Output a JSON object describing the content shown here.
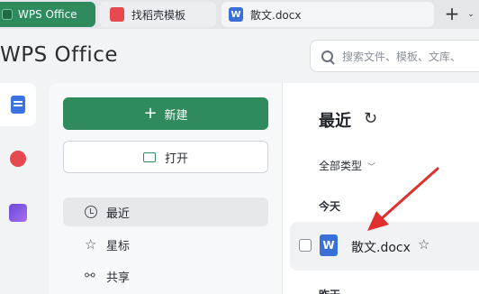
{
  "tabs": [
    {
      "label": "WPS Office",
      "icon": "wps-logo-icon",
      "active": true
    },
    {
      "label": "找稻壳模板",
      "icon": "docer-icon",
      "icon_color": "#e5484d"
    },
    {
      "label": "散文.docx",
      "icon": "word-doc-icon",
      "icon_glyph": "W",
      "icon_color": "#3a6fd8"
    }
  ],
  "tabbar": {
    "new_tab": "+",
    "menu": "⌄"
  },
  "header": {
    "brand": "WPS Office",
    "search_placeholder": "搜索文件、模板、文库、"
  },
  "sidebar": {
    "new_button": "新建",
    "open_button": "打开",
    "nav": [
      {
        "label": "最近",
        "icon": "clock-icon",
        "selected": true
      },
      {
        "label": "星标",
        "icon": "star-icon"
      },
      {
        "label": "共享",
        "icon": "share-icon"
      }
    ]
  },
  "main": {
    "title": "最近",
    "filter": "全部类型",
    "groups": [
      {
        "label": "今天",
        "files": [
          {
            "name": "散文.docx",
            "icon_glyph": "W"
          }
        ]
      },
      {
        "label": "昨天"
      }
    ]
  },
  "annotation": {
    "arrow_color": "#e0302d"
  },
  "colors": {
    "accent": "#2f8a5e",
    "word_blue": "#3a6fd8"
  }
}
